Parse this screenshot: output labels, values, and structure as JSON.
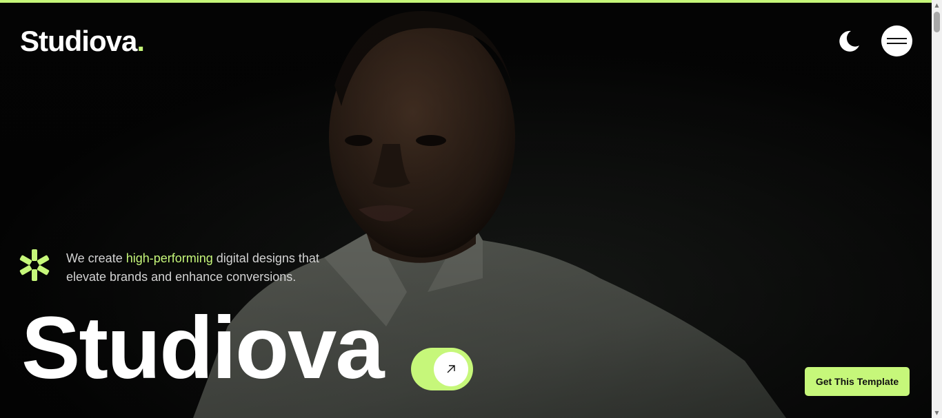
{
  "header": {
    "logo_text": "Studiova",
    "logo_dot": ".",
    "theme_toggle_icon": "moon-icon",
    "menu_icon": "hamburger-menu-icon"
  },
  "hero": {
    "image": "portrait-photo",
    "tagline_icon": "asterisk-burst-icon",
    "tagline_prefix": "We create ",
    "tagline_highlight": "high-performing",
    "tagline_suffix": " digital designs that elevate brands and enhance conversions.",
    "big_title": "Studiova",
    "cta_icon": "arrow-up-right-icon",
    "get_template_label": "Get This Template"
  },
  "colors": {
    "accent": "#c6f77a",
    "background": "#050505",
    "text": "#ffffff"
  },
  "scrollbar": {
    "up_icon": "scroll-up-arrow-icon",
    "down_icon": "scroll-down-arrow-icon"
  }
}
